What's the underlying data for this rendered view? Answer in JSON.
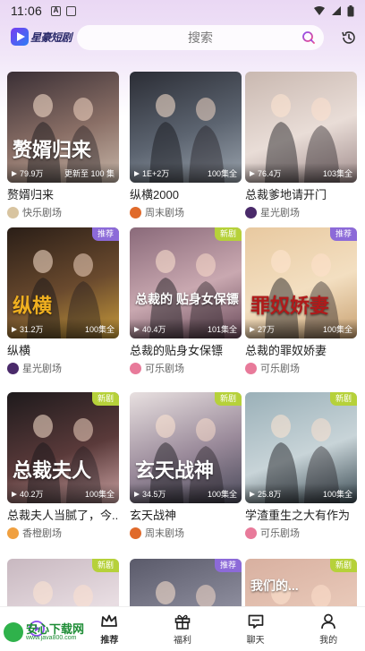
{
  "status": {
    "time": "11:06",
    "left_icons": [
      "A",
      "▪"
    ],
    "right_icons": [
      "wifi-icon",
      "signal-icon",
      "battery-icon"
    ]
  },
  "header": {
    "logo_text": "星豪短剧",
    "search_placeholder": "搜索"
  },
  "cards": [
    {
      "title": "赘婿归来",
      "views": "79.9万",
      "eps": "更新至 100 集",
      "badge": "",
      "studio": "快乐剧场",
      "thumb_text": "赘婿归来",
      "colors": [
        "#3a2f35",
        "#8a6f66",
        "#c7b6a8"
      ],
      "avatar": "#d8c4a0"
    },
    {
      "title": "纵横2000",
      "views": "1E+2万",
      "eps": "100集全",
      "badge": "",
      "studio": "周末剧场",
      "thumb_text": "",
      "colors": [
        "#2b2d35",
        "#5c6470",
        "#9aa3ad"
      ],
      "avatar": "#e06a2b"
    },
    {
      "title": "总裁爹地请开门",
      "views": "76.4万",
      "eps": "103集全",
      "badge": "",
      "studio": "星光剧场",
      "thumb_text": "",
      "colors": [
        "#c9b8b0",
        "#e9ddd7",
        "#a08c8c"
      ],
      "avatar": "#4a2a6a"
    },
    {
      "title": "纵横",
      "views": "31.2万",
      "eps": "100集全",
      "badge": "推荐",
      "studio": "星光剧场",
      "thumb_text": "纵横",
      "colors": [
        "#2a1e17",
        "#6a4a2e",
        "#c79a3a"
      ],
      "avatar": "#4a2a6a"
    },
    {
      "title": "总裁的贴身女保镖",
      "views": "40.4万",
      "eps": "101集全",
      "badge": "新剧",
      "studio": "可乐剧场",
      "thumb_text": "总裁的 贴身女保镖",
      "colors": [
        "#8a6a7a",
        "#c9a8b0",
        "#6a4a5a"
      ],
      "avatar": "#e87a9a"
    },
    {
      "title": "总裁的罪奴娇妻",
      "views": "27万",
      "eps": "100集全",
      "badge": "推荐",
      "studio": "可乐剧场",
      "thumb_text": "罪奴娇妻",
      "colors": [
        "#e8c9a0",
        "#f3dfc1",
        "#c8a070"
      ],
      "avatar": "#e87a9a"
    },
    {
      "title": "总裁夫人当腻了，今...",
      "views": "40.2万",
      "eps": "100集全",
      "badge": "新剧",
      "studio": "香橙剧场",
      "thumb_text": "总裁夫人",
      "colors": [
        "#1e1a1c",
        "#5a3a3a",
        "#c9a0a0"
      ],
      "avatar": "#f0a040"
    },
    {
      "title": "玄天战神",
      "views": "34.5万",
      "eps": "100集全",
      "badge": "新剧",
      "studio": "周末剧场",
      "thumb_text": "玄天战神",
      "colors": [
        "#e8e0e0",
        "#9a8a9a",
        "#4a4a5a"
      ],
      "avatar": "#e06a2b"
    },
    {
      "title": "学渣重生之大有作为",
      "views": "25.8万",
      "eps": "100集全",
      "badge": "新剧",
      "studio": "可乐剧场",
      "thumb_text": "",
      "colors": [
        "#9ab0b8",
        "#c8d4d8",
        "#3a4a52"
      ],
      "avatar": "#e87a9a"
    },
    {
      "title": "",
      "views": "",
      "eps": "",
      "badge": "新剧",
      "studio": "",
      "thumb_text": "",
      "colors": [
        "#c8b8c0",
        "#e8dde2",
        "#d8c8d0"
      ],
      "avatar": "#ffffff"
    },
    {
      "title": "",
      "views": "",
      "eps": "",
      "badge": "推荐",
      "studio": "",
      "thumb_text": "",
      "colors": [
        "#5a5a6a",
        "#8a8a9a",
        "#b0b0c0"
      ],
      "avatar": "#ffffff"
    },
    {
      "title": "",
      "views": "",
      "eps": "",
      "badge": "新剧",
      "studio": "",
      "thumb_text": "我们的...",
      "colors": [
        "#d8b0a0",
        "#e8c8b8",
        "#c89080"
      ],
      "avatar": "#ffffff"
    }
  ],
  "tabs": [
    {
      "label": "",
      "icon": "theater-icon",
      "active": false
    },
    {
      "label": "推荐",
      "icon": "crown-icon",
      "active": true
    },
    {
      "label": "福利",
      "icon": "gift-icon",
      "active": false
    },
    {
      "label": "聊天",
      "icon": "chat-icon",
      "active": false
    },
    {
      "label": "我的",
      "icon": "user-icon",
      "active": false
    }
  ],
  "watermark": {
    "text": "安心下载网",
    "sub": "www.java800.com"
  }
}
